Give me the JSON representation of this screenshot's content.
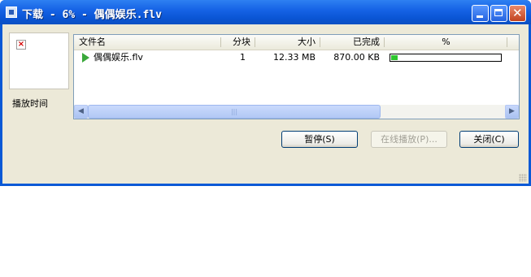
{
  "window": {
    "title": "下载 - 6% - 偶偶娱乐.flv"
  },
  "preview": {
    "label": "播放时间"
  },
  "list": {
    "columns": [
      "文件名",
      "分块",
      "大小",
      "已完成",
      "%"
    ],
    "rows": [
      {
        "filename": "偶偶娱乐.flv",
        "chunks": "1",
        "size": "12.33 MB",
        "completed": "870.00 KB",
        "progress_percent": 6
      }
    ]
  },
  "scrollbar": {
    "thumb_grip": "|||"
  },
  "buttons": {
    "pause": "暂停(S)",
    "play_online": "在线播放(P)...",
    "close": "关闭(C)"
  },
  "colors": {
    "title_bar": "#0A55D4",
    "dialog_bg": "#ECE9D8",
    "progress_fill": "#2EC52E",
    "play_icon": "#3AA83A"
  }
}
